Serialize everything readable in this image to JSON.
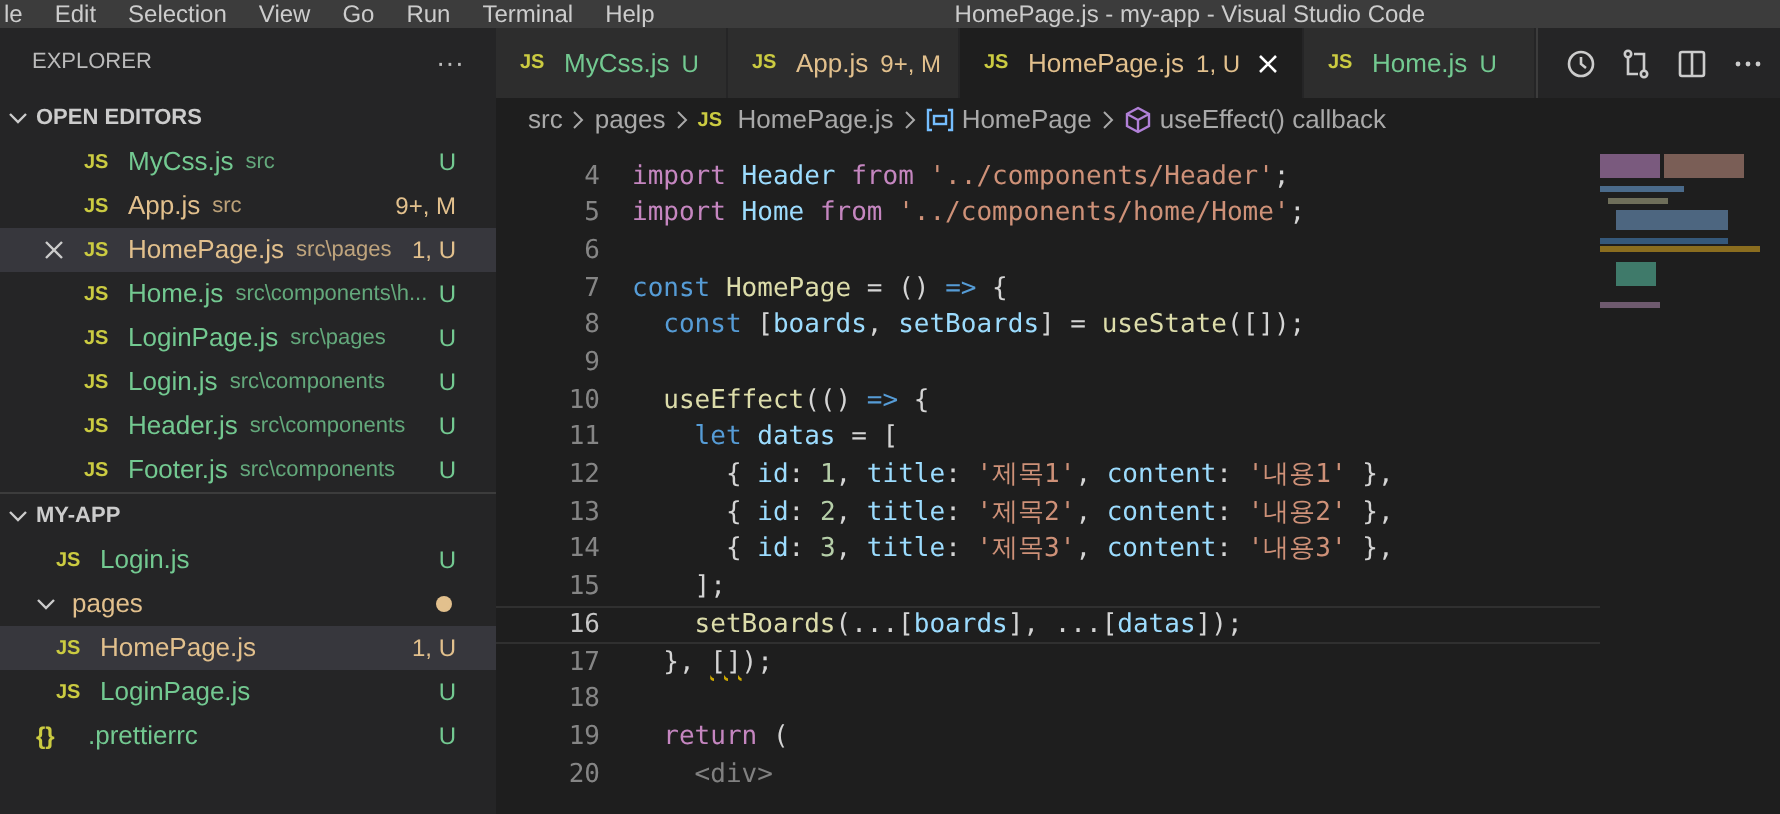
{
  "menu": [
    "le",
    "Edit",
    "Selection",
    "View",
    "Go",
    "Run",
    "Terminal",
    "Help"
  ],
  "window": {
    "title": "HomePage.js - my-app - Visual Studio Code"
  },
  "sidebar": {
    "title": "EXPLORER",
    "more": "···",
    "sections": [
      {
        "title": "OPEN EDITORS",
        "expanded": true,
        "items": [
          {
            "kind": "file",
            "icon": "JS",
            "name": "MyCss.js",
            "path": "src",
            "badge": "U",
            "color": "#73c991",
            "selected": false
          },
          {
            "kind": "file",
            "icon": "JS",
            "name": "App.js",
            "path": "src",
            "badge": "9+, M",
            "color": "#e2c08d",
            "selected": false
          },
          {
            "kind": "file",
            "icon": "JS",
            "name": "HomePage.js",
            "path": "src\\pages",
            "badge": "1, U",
            "color": "#e2c08d",
            "selected": true
          },
          {
            "kind": "file",
            "icon": "JS",
            "name": "Home.js",
            "path": "src\\components\\h...",
            "badge": "U",
            "color": "#73c991",
            "selected": false
          },
          {
            "kind": "file",
            "icon": "JS",
            "name": "LoginPage.js",
            "path": "src\\pages",
            "badge": "U",
            "color": "#73c991",
            "selected": false
          },
          {
            "kind": "file",
            "icon": "JS",
            "name": "Login.js",
            "path": "src\\components",
            "badge": "U",
            "color": "#73c991",
            "selected": false
          },
          {
            "kind": "file",
            "icon": "JS",
            "name": "Header.js",
            "path": "src\\components",
            "badge": "U",
            "color": "#73c991",
            "selected": false
          },
          {
            "kind": "file",
            "icon": "JS",
            "name": "Footer.js",
            "path": "src\\components",
            "badge": "U",
            "color": "#73c991",
            "selected": false
          }
        ]
      },
      {
        "title": "MY-APP",
        "expanded": true,
        "items": [
          {
            "kind": "file",
            "icon": "JS",
            "name": "Login.js",
            "badge": "U",
            "color": "#73c991",
            "selected": false
          },
          {
            "kind": "folder",
            "name": "pages",
            "color": "#e2c08d",
            "expanded": true,
            "selected": false,
            "children": [
              {
                "kind": "file",
                "icon": "JS",
                "name": "HomePage.js",
                "badge": "1, U",
                "color": "#e2c08d",
                "selected": true
              },
              {
                "kind": "file",
                "icon": "JS",
                "name": "LoginPage.js",
                "badge": "U",
                "color": "#73c991",
                "selected": false
              }
            ]
          },
          {
            "kind": "config",
            "icon": "{}",
            "name": ".prettierrc",
            "badge": "U",
            "color": "#73c991",
            "selected": false
          }
        ]
      }
    ]
  },
  "tabs": [
    {
      "icon": "JS",
      "label": "MyCss.js",
      "badge": "U",
      "color": "#73c991",
      "selected": false
    },
    {
      "icon": "JS",
      "label": "App.js",
      "badge": "9+, M",
      "color": "#e2c08d",
      "selected": false
    },
    {
      "icon": "JS",
      "label": "HomePage.js",
      "badge": "1, U",
      "color": "#e2c08d",
      "selected": true
    },
    {
      "icon": "JS",
      "label": "Home.js",
      "badge": "U",
      "color": "#73c991",
      "selected": false
    }
  ],
  "breadcrumb": [
    {
      "kind": "folder",
      "text": "src"
    },
    {
      "kind": "folder",
      "text": "pages"
    },
    {
      "kind": "file",
      "icon": "JS",
      "text": "HomePage.js"
    },
    {
      "kind": "variable",
      "text": "HomePage"
    },
    {
      "kind": "method",
      "text": "useEffect() callback"
    }
  ],
  "code": [
    {
      "num": "4",
      "tokens": [
        {
          "kind": "kw",
          "text": "import "
        },
        {
          "kind": "var",
          "text": "Header "
        },
        {
          "kind": "kw",
          "text": "from "
        },
        {
          "kind": "str",
          "text": "'../components/Header'"
        },
        {
          "kind": "p",
          "text": ";"
        }
      ]
    },
    {
      "num": "5",
      "tokens": [
        {
          "kind": "kw",
          "text": "import "
        },
        {
          "kind": "var",
          "text": "Home "
        },
        {
          "kind": "kw",
          "text": "from "
        },
        {
          "kind": "str",
          "text": "'../components/home/Home'"
        },
        {
          "kind": "p",
          "text": ";"
        }
      ]
    },
    {
      "num": "6"
    },
    {
      "num": "7",
      "tokens": [
        {
          "kind": "st",
          "text": "const "
        },
        {
          "kind": "fn",
          "text": "HomePage "
        },
        {
          "kind": "p",
          "text": "= () "
        },
        {
          "kind": "st",
          "text": "=> "
        },
        {
          "kind": "p",
          "text": "{"
        }
      ]
    },
    {
      "num": "8",
      "tokens": [
        {
          "kind": "st",
          "text": "  const "
        },
        {
          "kind": "p",
          "text": "["
        },
        {
          "kind": "var",
          "text": "boards"
        },
        {
          "kind": "p",
          "text": ", "
        },
        {
          "kind": "var",
          "text": "setBoards"
        },
        {
          "kind": "p",
          "text": "] = "
        },
        {
          "kind": "fn",
          "text": "useState"
        },
        {
          "kind": "p",
          "text": "([]);"
        }
      ]
    },
    {
      "num": "9"
    },
    {
      "num": "10",
      "tokens": [
        {
          "kind": "fn",
          "text": "  useEffect"
        },
        {
          "kind": "p",
          "text": "(() "
        },
        {
          "kind": "st",
          "text": "=> "
        },
        {
          "kind": "p",
          "text": "{"
        }
      ]
    },
    {
      "num": "11",
      "tokens": [
        {
          "kind": "st",
          "text": "    let "
        },
        {
          "kind": "var",
          "text": "datas "
        },
        {
          "kind": "p",
          "text": "= ["
        }
      ]
    },
    {
      "num": "12",
      "tokens": [
        {
          "kind": "p",
          "text": "      { "
        },
        {
          "kind": "var",
          "text": "id"
        },
        {
          "kind": "p",
          "text": ": "
        },
        {
          "kind": "num",
          "text": "1"
        },
        {
          "kind": "p",
          "text": ", "
        },
        {
          "kind": "var",
          "text": "title"
        },
        {
          "kind": "p",
          "text": ": "
        },
        {
          "kind": "str",
          "text": "'제목1'"
        },
        {
          "kind": "p",
          "text": ", "
        },
        {
          "kind": "var",
          "text": "content"
        },
        {
          "kind": "p",
          "text": ": "
        },
        {
          "kind": "str",
          "text": "'내용1'"
        },
        {
          "kind": "p",
          "text": " },"
        }
      ]
    },
    {
      "num": "13",
      "tokens": [
        {
          "kind": "p",
          "text": "      { "
        },
        {
          "kind": "var",
          "text": "id"
        },
        {
          "kind": "p",
          "text": ": "
        },
        {
          "kind": "num",
          "text": "2"
        },
        {
          "kind": "p",
          "text": ", "
        },
        {
          "kind": "var",
          "text": "title"
        },
        {
          "kind": "p",
          "text": ": "
        },
        {
          "kind": "str",
          "text": "'제목2'"
        },
        {
          "kind": "p",
          "text": ", "
        },
        {
          "kind": "var",
          "text": "content"
        },
        {
          "kind": "p",
          "text": ": "
        },
        {
          "kind": "str",
          "text": "'내용2'"
        },
        {
          "kind": "p",
          "text": " },"
        }
      ]
    },
    {
      "num": "14",
      "tokens": [
        {
          "kind": "p",
          "text": "      { "
        },
        {
          "kind": "var",
          "text": "id"
        },
        {
          "kind": "p",
          "text": ": "
        },
        {
          "kind": "num",
          "text": "3"
        },
        {
          "kind": "p",
          "text": ", "
        },
        {
          "kind": "var",
          "text": "title"
        },
        {
          "kind": "p",
          "text": ": "
        },
        {
          "kind": "str",
          "text": "'제목3'"
        },
        {
          "kind": "p",
          "text": ", "
        },
        {
          "kind": "var",
          "text": "content"
        },
        {
          "kind": "p",
          "text": ": "
        },
        {
          "kind": "str",
          "text": "'내용3'"
        },
        {
          "kind": "p",
          "text": " },"
        }
      ]
    },
    {
      "num": "15",
      "tokens": [
        {
          "kind": "p",
          "text": "    ];"
        }
      ]
    },
    {
      "num": "16",
      "current": true,
      "tokens": [
        {
          "kind": "fn",
          "text": "    setBoards"
        },
        {
          "kind": "p",
          "text": "(...["
        },
        {
          "kind": "var",
          "text": "boards"
        },
        {
          "kind": "p",
          "text": "], ...["
        },
        {
          "kind": "var",
          "text": "datas"
        },
        {
          "kind": "p",
          "text": "]);"
        }
      ]
    },
    {
      "num": "17",
      "tokens": [
        {
          "kind": "p",
          "text": "  }, "
        },
        {
          "kind": "p",
          "text": "[]",
          "squiggle": true
        },
        {
          "kind": "p",
          "text": ");"
        }
      ]
    },
    {
      "num": "18"
    },
    {
      "num": "19",
      "tokens": [
        {
          "kind": "kw",
          "text": "  return "
        },
        {
          "kind": "p",
          "text": "("
        }
      ]
    },
    {
      "num": "20",
      "tokens": [
        {
          "kind": "tag",
          "text": "    <div>"
        }
      ]
    }
  ]
}
